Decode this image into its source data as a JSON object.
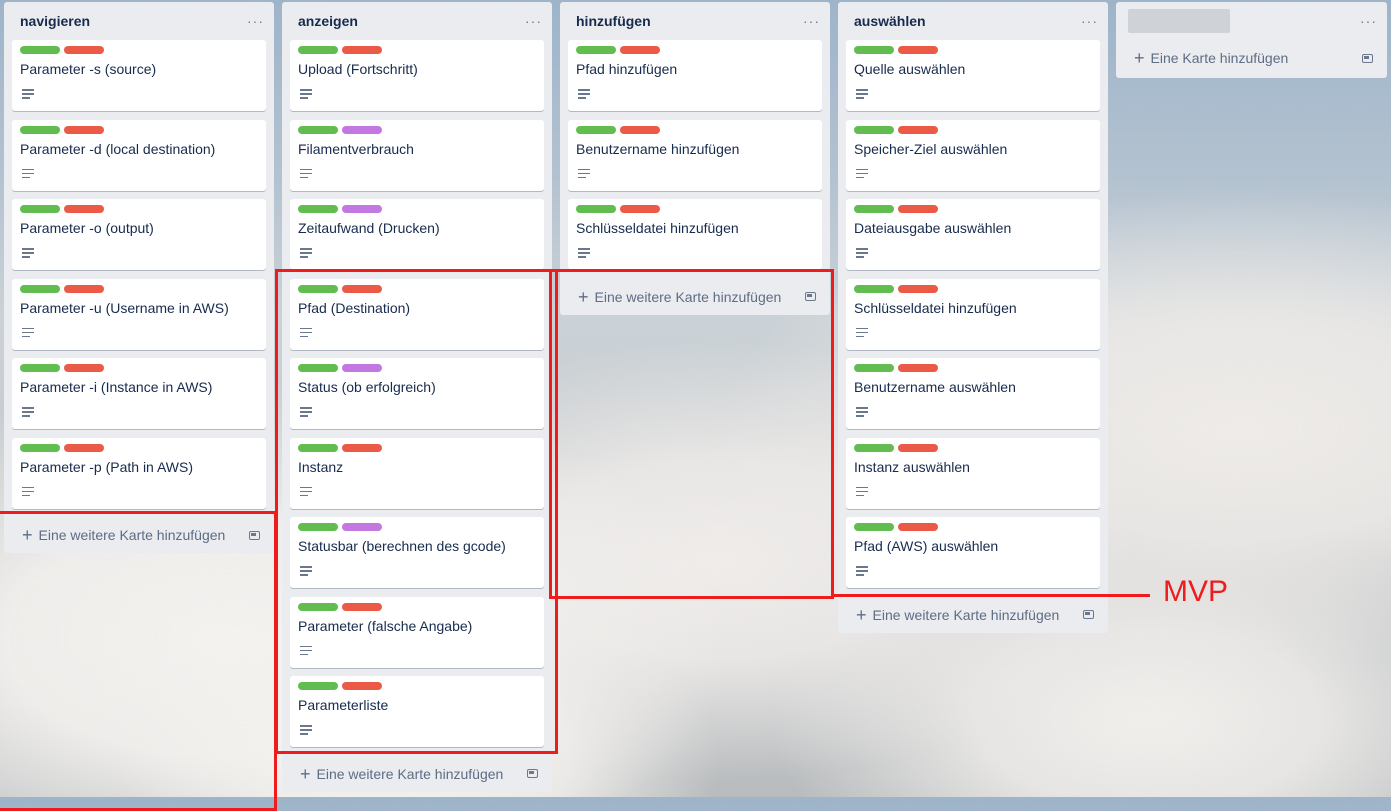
{
  "board": {
    "lists": [
      {
        "title": "navigieren",
        "menu": "···",
        "add_label": "Eine weitere Karte hinzufügen",
        "cards": [
          {
            "title": "Parameter -s (source)",
            "labels": [
              "green",
              "red"
            ]
          },
          {
            "title": "Parameter -d (local destination)",
            "labels": [
              "green",
              "red"
            ]
          },
          {
            "title": "Parameter -o (output)",
            "labels": [
              "green",
              "red"
            ]
          },
          {
            "title": "Parameter -u (Username in AWS)",
            "labels": [
              "green",
              "red"
            ]
          },
          {
            "title": "Parameter -i (Instance in AWS)",
            "labels": [
              "green",
              "red"
            ]
          },
          {
            "title": "Parameter -p (Path in AWS)",
            "labels": [
              "green",
              "red"
            ]
          }
        ]
      },
      {
        "title": "anzeigen",
        "menu": "···",
        "add_label": "Eine weitere Karte hinzufügen",
        "cards": [
          {
            "title": "Upload (Fortschritt)",
            "labels": [
              "green",
              "red"
            ]
          },
          {
            "title": "Filamentverbrauch",
            "labels": [
              "green",
              "purple"
            ]
          },
          {
            "title": "Zeitaufwand (Drucken)",
            "labels": [
              "green",
              "purple"
            ]
          },
          {
            "title": "Pfad (Destination)",
            "labels": [
              "green",
              "red"
            ]
          },
          {
            "title": "Status (ob erfolgreich)",
            "labels": [
              "green",
              "purple"
            ]
          },
          {
            "title": "Instanz",
            "labels": [
              "green",
              "red"
            ]
          },
          {
            "title": "Statusbar (berechnen des gcode)",
            "labels": [
              "green",
              "purple"
            ]
          },
          {
            "title": "Parameter (falsche Angabe)",
            "labels": [
              "green",
              "red"
            ]
          },
          {
            "title": "Parameterliste",
            "labels": [
              "green",
              "red"
            ]
          }
        ]
      },
      {
        "title": "hinzufügen",
        "menu": "···",
        "add_label": "Eine weitere Karte hinzufügen",
        "cards": [
          {
            "title": "Pfad hinzufügen",
            "labels": [
              "green",
              "red"
            ]
          },
          {
            "title": "Benutzername hinzufügen",
            "labels": [
              "green",
              "red"
            ]
          },
          {
            "title": "Schlüsseldatei hinzufügen",
            "labels": [
              "green",
              "red"
            ]
          }
        ]
      },
      {
        "title": "auswählen",
        "menu": "···",
        "add_label": "Eine weitere Karte hinzufügen",
        "cards": [
          {
            "title": "Quelle auswählen",
            "labels": [
              "green",
              "red"
            ]
          },
          {
            "title": "Speicher-Ziel auswählen",
            "labels": [
              "green",
              "red"
            ]
          },
          {
            "title": "Dateiausgabe auswählen",
            "labels": [
              "green",
              "red"
            ]
          },
          {
            "title": "Schlüsseldatei hinzufügen",
            "labels": [
              "green",
              "red"
            ]
          },
          {
            "title": "Benutzername auswählen",
            "labels": [
              "green",
              "red"
            ]
          },
          {
            "title": "Instanz auswählen",
            "labels": [
              "green",
              "red"
            ]
          },
          {
            "title": "Pfad (AWS) auswählen",
            "labels": [
              "green",
              "red"
            ]
          }
        ]
      }
    ],
    "new_list": {
      "menu": "···",
      "add_label": "Eine Karte hinzufügen"
    }
  },
  "annotation": {
    "mvp_label": "MVP",
    "color": "#ee1c1c"
  },
  "colors": {
    "label_green": "#61bd4f",
    "label_red": "#eb5a46",
    "label_purple": "#c377e0",
    "list_bg": "#ebecf0",
    "card_bg": "#ffffff",
    "text": "#172b4d"
  },
  "icons": {
    "list_menu": "ellipsis-icon",
    "card_description": "description-icon",
    "add": "plus-icon",
    "template": "card-template-icon"
  }
}
